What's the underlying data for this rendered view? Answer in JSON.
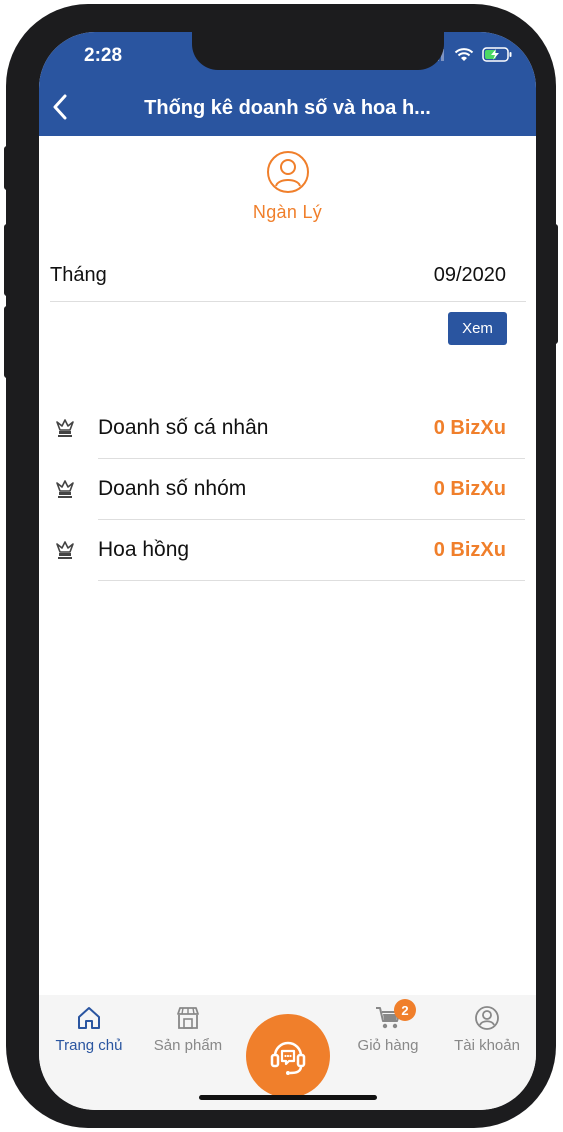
{
  "status_bar": {
    "time": "2:28"
  },
  "header": {
    "title": "Thống kê doanh số và hoa h..."
  },
  "user": {
    "name": "Ngàn Lý"
  },
  "filter": {
    "month_label": "Tháng",
    "month_value": "09/2020",
    "view_button": "Xem"
  },
  "stats": [
    {
      "label": "Doanh số cá nhân",
      "value": "0 BizXu",
      "icon": "crown-icon"
    },
    {
      "label": "Doanh số nhóm",
      "value": "0 BizXu",
      "icon": "crown-icon"
    },
    {
      "label": "Hoa hồng",
      "value": "0 BizXu",
      "icon": "crown-icon"
    }
  ],
  "tabbar": {
    "home": "Trang chủ",
    "products": "Sản phẩm",
    "cart": "Giỏ hàng",
    "cart_badge": "2",
    "account": "Tài khoản"
  },
  "colors": {
    "primary": "#2a55a0",
    "accent": "#f07f2b",
    "tab_inactive": "#888888"
  }
}
